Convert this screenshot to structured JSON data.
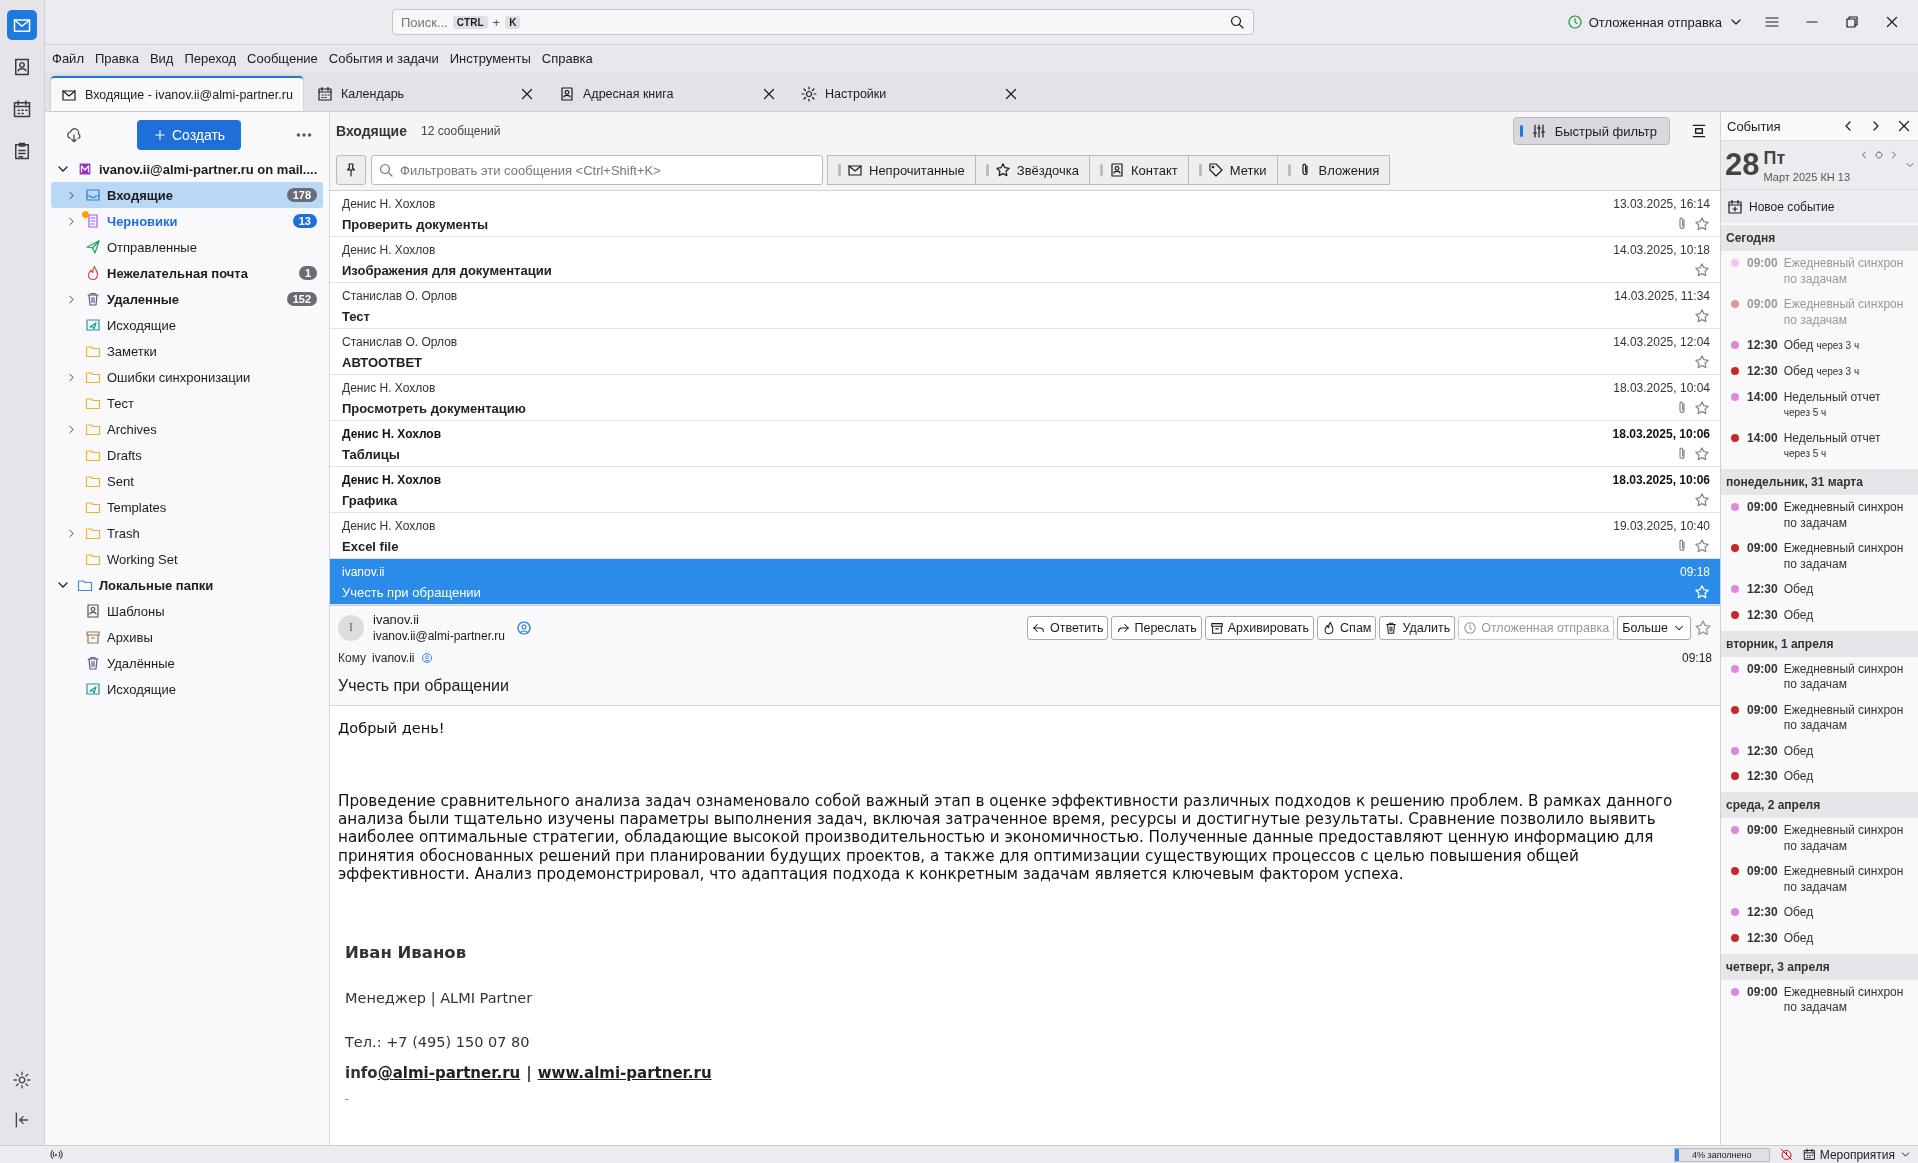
{
  "spaces": [
    {
      "kind": "mail",
      "selected": true
    },
    {
      "kind": "contacts",
      "selected": false
    },
    {
      "kind": "calendar",
      "selected": false
    },
    {
      "kind": "tasks",
      "selected": false
    }
  ],
  "search": {
    "placeholder": "Поиск...",
    "keys": [
      "CTRL",
      "K"
    ],
    "joiner": "+"
  },
  "scheduled_send": "Отложенная отправка",
  "menu": [
    "Файл",
    "Правка",
    "Вид",
    "Переход",
    "Сообщение",
    "События и задачи",
    "Инструменты",
    "Справка"
  ],
  "tabs": [
    {
      "label": "Входящие - ivanov.ii@almi-partner.ru",
      "kind": "mail",
      "selected": true
    },
    {
      "label": "Календарь",
      "kind": "calendar",
      "selected": false
    },
    {
      "label": "Адресная книга",
      "kind": "contacts",
      "selected": false
    },
    {
      "label": "Настройки",
      "kind": "settings",
      "selected": false
    }
  ],
  "folder_pane": {
    "new_button": "Создать",
    "accounts": [
      {
        "name": "ivanov.ii@almi-partner.ru on mail....",
        "kind": "imap",
        "expanded": true,
        "children": [
          {
            "name": "Входящие",
            "kind": "inbox",
            "count": "178",
            "has_children": true,
            "selected": true,
            "new_mail": false
          },
          {
            "name": "Черновики",
            "kind": "drafts",
            "count": "13",
            "has_children": true,
            "selected": false,
            "new_mail": true
          },
          {
            "name": "Отправленные",
            "kind": "sent",
            "has_children": false,
            "selected": false,
            "new_mail": false
          },
          {
            "name": "Нежелательная почта",
            "kind": "junk",
            "count": "1",
            "has_children": false,
            "selected": false,
            "new_mail": false
          },
          {
            "name": "Удаленные",
            "kind": "trash",
            "count": "152",
            "has_children": true,
            "selected": false,
            "new_mail": false
          },
          {
            "name": "Исходящие",
            "kind": "outbox",
            "has_children": false,
            "selected": false,
            "new_mail": false
          },
          {
            "name": "Заметки",
            "kind": "folder",
            "has_children": false,
            "selected": false,
            "new_mail": false
          },
          {
            "name": "Ошибки синхронизации",
            "kind": "folder",
            "has_children": true,
            "selected": false,
            "new_mail": false
          },
          {
            "name": "Тест",
            "kind": "folder",
            "has_children": false,
            "selected": false,
            "new_mail": false
          },
          {
            "name": "Archives",
            "kind": "folder",
            "has_children": true,
            "selected": false,
            "new_mail": false
          },
          {
            "name": "Drafts",
            "kind": "folder",
            "has_children": false,
            "selected": false,
            "new_mail": false
          },
          {
            "name": "Sent",
            "kind": "folder",
            "has_children": false,
            "selected": false,
            "new_mail": false
          },
          {
            "name": "Templates",
            "kind": "folder",
            "has_children": false,
            "selected": false,
            "new_mail": false
          },
          {
            "name": "Trash",
            "kind": "folder",
            "has_children": true,
            "selected": false,
            "new_mail": false
          },
          {
            "name": "Working Set",
            "kind": "folder",
            "has_children": false,
            "selected": false,
            "new_mail": false
          }
        ]
      },
      {
        "name": "Локальные папки",
        "kind": "local",
        "expanded": true,
        "children": [
          {
            "name": "Шаблоны",
            "kind": "templates",
            "has_children": false,
            "selected": false,
            "new_mail": false
          },
          {
            "name": "Архивы",
            "kind": "archive",
            "has_children": false,
            "selected": false,
            "new_mail": false
          },
          {
            "name": "Удалённые",
            "kind": "trash",
            "has_children": false,
            "selected": false,
            "new_mail": false
          },
          {
            "name": "Исходящие",
            "kind": "outbox",
            "has_children": false,
            "selected": false,
            "new_mail": false
          }
        ]
      }
    ]
  },
  "message_list": {
    "folder": "Входящие",
    "count": "12 сообщений",
    "quick_filter": {
      "label": "Быстрый фильтр",
      "on": true
    },
    "filter_placeholder": "Фильтровать эти сообщения <Ctrl+Shift+K>",
    "filters": [
      {
        "label": "Непрочитанные",
        "kind": "unread"
      },
      {
        "label": "Звёздочка",
        "kind": "starred"
      },
      {
        "label": "Контакт",
        "kind": "contact"
      },
      {
        "label": "Метки",
        "kind": "tags"
      },
      {
        "label": "Вложения",
        "kind": "attachments"
      }
    ],
    "rows": [
      {
        "sender": "Денис Н. Хохлов",
        "subject": "Проверить документы",
        "date": "13.03.2025, 16:14",
        "attachment": true,
        "unread": false,
        "starred": false,
        "selected": false
      },
      {
        "sender": "Денис Н. Хохлов",
        "subject": "Изображения для документации",
        "date": "14.03.2025, 10:18",
        "attachment": false,
        "unread": false,
        "starred": false,
        "selected": false
      },
      {
        "sender": "Станислав О. Орлов",
        "subject": "Тест",
        "date": "14.03.2025, 11:34",
        "attachment": false,
        "unread": false,
        "starred": false,
        "selected": false
      },
      {
        "sender": "Станислав О. Орлов",
        "subject": "АВТООТВЕТ",
        "date": "14.03.2025, 12:04",
        "attachment": false,
        "unread": false,
        "starred": false,
        "selected": false
      },
      {
        "sender": "Денис Н. Хохлов",
        "subject": "Просмотреть документацию",
        "date": "18.03.2025, 10:04",
        "attachment": true,
        "unread": false,
        "starred": false,
        "selected": false
      },
      {
        "sender": "Денис Н. Хохлов",
        "subject": "Таблицы",
        "date": "18.03.2025, 10:06",
        "attachment": true,
        "unread": true,
        "starred": false,
        "selected": false
      },
      {
        "sender": "Денис Н. Хохлов",
        "subject": "Графика",
        "date": "18.03.2025, 10:06",
        "attachment": false,
        "unread": true,
        "starred": false,
        "selected": false
      },
      {
        "sender": "Денис Н. Хохлов",
        "subject": "Excel file",
        "date": "19.03.2025, 10:40",
        "attachment": true,
        "unread": false,
        "starred": false,
        "selected": false
      },
      {
        "sender": "ivanov.ii",
        "subject": "Учесть при обращении",
        "date": "09:18",
        "attachment": false,
        "unread": false,
        "starred": false,
        "selected": true
      }
    ]
  },
  "message": {
    "avatar": "I",
    "from_name": "ivanov.ii",
    "from_email": "ivanov.ii@almi-partner.ru",
    "actions": [
      {
        "label": "Ответить",
        "kind": "reply",
        "disabled": false
      },
      {
        "label": "Переслать",
        "kind": "forward",
        "disabled": false
      },
      {
        "label": "Архивировать",
        "kind": "archive",
        "disabled": false
      },
      {
        "label": "Спам",
        "kind": "junk",
        "disabled": false
      },
      {
        "label": "Удалить",
        "kind": "delete",
        "disabled": false
      },
      {
        "label": "Отложенная отправка",
        "kind": "schedule",
        "disabled": true
      }
    ],
    "more": "Больше",
    "to_label": "Кому",
    "to": "ivanov.ii",
    "time": "09:18",
    "subject": "Учесть при обращении",
    "greeting": "Добрый день!",
    "paragraph": "Проведение сравнительного анализа задач ознаменовало собой важный этап в оценке эффективности различных подходов к решению проблем. В рамках данного анализа были тщательно изучены параметры выполнения задач, включая затраченное время, ресурсы и достигнутые результаты. Сравнение позволило выявить наиболее оптимальные стратегии, обладающие высокой производительностью и экономичностью. Полученные данные предоставляют ценную информацию для принятия обоснованных решений при планировании будущих проектов, а также для оптимизации существующих процессов с целью повышения общей эффективности. Анализ продемонстрировал, что адаптация подхода к конкретным задачам является ключевым фактором успеха.",
    "signature": {
      "name": "Иван Иванов",
      "role": "Менеджер | ALMI Partner",
      "phone": "Тел.: +7 (495) 150 07 80",
      "email_prefix": "info",
      "email_link": "@almi-partner.ru",
      "separator": "|",
      "site": "www.almi-partner.ru",
      "tail": "-"
    }
  },
  "events": {
    "title": "События",
    "day": "28",
    "weekday": "Пт",
    "month": "Март 2025",
    "week": "КН 13",
    "new_event": "Новое событие",
    "sections": [
      {
        "heading": "Сегодня",
        "items": [
          {
            "time": "09:00",
            "title": "Ежедневный синхрон по задачам",
            "color": "#f0c4f0",
            "past": true
          },
          {
            "time": "09:00",
            "title": "Ежедневный синхрон по задачам",
            "color": "#e39a94",
            "past": true
          },
          {
            "time": "12:30",
            "title": "Обед",
            "hint": "через 3 ч",
            "color": "#dd88dd",
            "past": false
          },
          {
            "time": "12:30",
            "title": "Обед",
            "hint": "через 3 ч",
            "color": "#c62828",
            "past": false
          },
          {
            "time": "14:00",
            "title": "Недельный отчет",
            "hint": "через 5 ч",
            "color": "#dd88dd",
            "past": false
          },
          {
            "time": "14:00",
            "title": "Недельный отчет",
            "hint": "через 5 ч",
            "color": "#c62828",
            "past": false
          }
        ]
      },
      {
        "heading": "понедельник, 31 марта",
        "items": [
          {
            "time": "09:00",
            "title": "Ежедневный синхрон по задачам",
            "color": "#dd88dd",
            "past": false
          },
          {
            "time": "09:00",
            "title": "Ежедневный синхрон по задачам",
            "color": "#c62828",
            "past": false
          },
          {
            "time": "12:30",
            "title": "Обед",
            "color": "#dd88dd",
            "past": false
          },
          {
            "time": "12:30",
            "title": "Обед",
            "color": "#c62828",
            "past": false
          }
        ]
      },
      {
        "heading": "вторник, 1 апреля",
        "items": [
          {
            "time": "09:00",
            "title": "Ежедневный синхрон по задачам",
            "color": "#dd88dd",
            "past": false
          },
          {
            "time": "09:00",
            "title": "Ежедневный синхрон по задачам",
            "color": "#c62828",
            "past": false
          },
          {
            "time": "12:30",
            "title": "Обед",
            "color": "#dd88dd",
            "past": false
          },
          {
            "time": "12:30",
            "title": "Обед",
            "color": "#c62828",
            "past": false
          }
        ]
      },
      {
        "heading": "среда, 2 апреля",
        "items": [
          {
            "time": "09:00",
            "title": "Ежедневный синхрон по задачам",
            "color": "#dd88dd",
            "past": false
          },
          {
            "time": "09:00",
            "title": "Ежедневный синхрон по задачам",
            "color": "#c62828",
            "past": false
          },
          {
            "time": "12:30",
            "title": "Обед",
            "color": "#dd88dd",
            "past": false
          },
          {
            "time": "12:30",
            "title": "Обед",
            "color": "#c62828",
            "past": false
          }
        ]
      },
      {
        "heading": "четверг, 3 апреля",
        "items": [
          {
            "time": "09:00",
            "title": "Ежедневный синхрон по задачам",
            "color": "#dd88dd",
            "past": false
          }
        ]
      }
    ]
  },
  "status_bar": {
    "quota": {
      "label": "4% заполнено",
      "level": 0.04
    },
    "events_menu": "Мероприятия"
  }
}
